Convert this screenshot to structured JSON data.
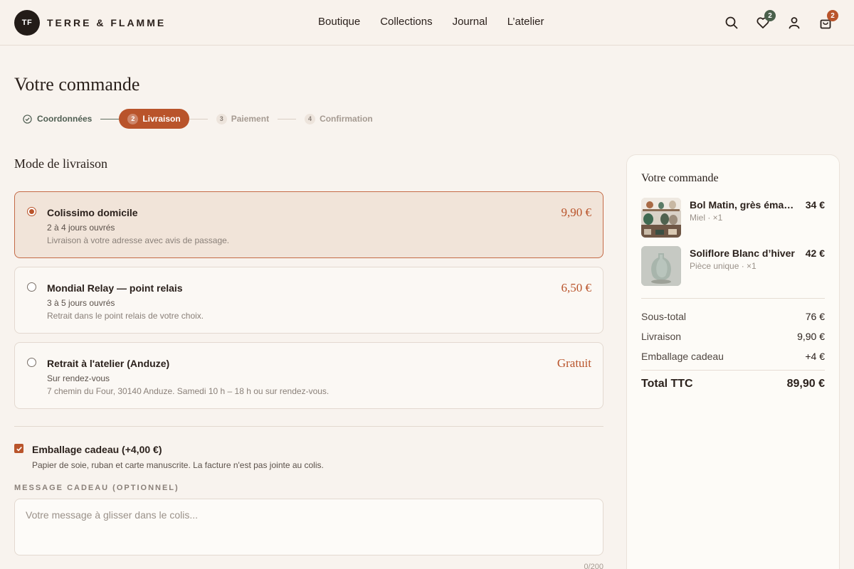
{
  "header": {
    "logo_mark": "TF",
    "brand": "TERRE & FLAMME",
    "nav": [
      "Boutique",
      "Collections",
      "Journal",
      "L’atelier"
    ],
    "wishlist_count": "2",
    "cart_count": "2",
    "icons": [
      "search-icon",
      "heart-icon",
      "user-icon",
      "bag-icon"
    ]
  },
  "page": {
    "title": "Votre commande",
    "steps": [
      {
        "num": "",
        "label": "Coordonnées",
        "state": "done"
      },
      {
        "num": "2",
        "label": "Livraison",
        "state": "active"
      },
      {
        "num": "3",
        "label": "Paiement",
        "state": "todo"
      },
      {
        "num": "4",
        "label": "Confirmation",
        "state": "todo"
      }
    ]
  },
  "shipping": {
    "title": "Mode de livraison",
    "options": [
      {
        "name": "Colissimo domicile",
        "delay": "2 à 4 jours ouvrés",
        "desc": "Livraison à votre adresse avec avis de passage.",
        "price": "9,90 €",
        "selected": true
      },
      {
        "name": "Mondial Relay — point relais",
        "delay": "3 à 5 jours ouvrés",
        "desc": "Retrait dans le point relais de votre choix.",
        "price": "6,50 €",
        "selected": false
      },
      {
        "name": "Retrait à l'atelier (Anduze)",
        "delay": "Sur rendez-vous",
        "desc": "7 chemin du Four, 30140 Anduze. Samedi 10 h – 18 h ou sur rendez-vous.",
        "price": "Gratuit",
        "selected": false
      }
    ]
  },
  "gift": {
    "checked": true,
    "title": "Emballage cadeau (+4,00 €)",
    "desc": "Papier de soie, ruban et carte manuscrite. La facture n'est pas jointe au colis.",
    "message_label": "MESSAGE CADEAU (OPTIONNEL)",
    "message_placeholder": "Votre message à glisser dans le colis...",
    "message_value": "",
    "counter": "0/200"
  },
  "summary": {
    "title": "Votre commande",
    "items": [
      {
        "name": "Bol Matin, grès émaillé",
        "meta": "Miel · ×1",
        "price": "34 €"
      },
      {
        "name": "Soliflore Blanc d’hiver",
        "meta": "Pièce unique · ×1",
        "price": "42 €"
      }
    ],
    "rows": [
      {
        "label": "Sous-total",
        "value": "76 €"
      },
      {
        "label": "Livraison",
        "value": "9,90 €"
      },
      {
        "label": "Emballage cadeau",
        "value": "+4 €"
      }
    ],
    "total": {
      "label": "Total TTC",
      "value": "89,90 €"
    }
  },
  "colors": {
    "accent": "#b9542b",
    "success": "#4a5f4b",
    "background": "#f8f3ee",
    "text": "#2b211c"
  }
}
